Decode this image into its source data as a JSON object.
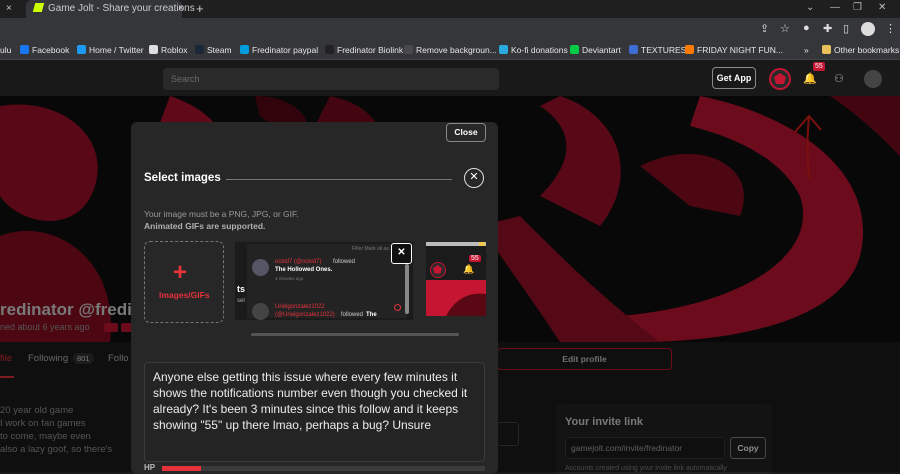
{
  "browser": {
    "tabs": [
      {
        "label": "× ",
        "active": false
      },
      {
        "label": "Game Jolt - Share your creations",
        "active": true
      }
    ],
    "close_glyph": "×",
    "new_tab_glyph": "+",
    "bookmarks": [
      {
        "label": "ulu",
        "color": "#1ce783"
      },
      {
        "label": "Facebook",
        "color": "#1877f2"
      },
      {
        "label": "Home / Twitter",
        "color": "#1d9bf0"
      },
      {
        "label": "Roblox",
        "color": "#dddddd"
      },
      {
        "label": "Steam",
        "color": "#1b2838"
      },
      {
        "label": "Fredinator paypal",
        "color": "#009cde"
      },
      {
        "label": "Fredinator Biolink",
        "color": "#222222"
      },
      {
        "label": "Remove backgroun...",
        "color": "#4a4a4a"
      },
      {
        "label": "Ko-fi donations",
        "color": "#29abe0"
      },
      {
        "label": "Deviantart",
        "color": "#05cc47"
      },
      {
        "label": "TEXTURES",
        "color": "#3f6dd3"
      },
      {
        "label": "FRIDAY NIGHT FUN...",
        "color": "#ff7a00"
      }
    ],
    "other_bookmarks": "Other bookmarks",
    "more_glyph": "»"
  },
  "header": {
    "search_placeholder": "Search",
    "get_app": "Get App",
    "notification_count": "55"
  },
  "profile": {
    "name": "redinator @fredinato",
    "joined": "ned about 6 years ago",
    "tabs": {
      "profile": "file",
      "following": "Following",
      "following_count": "801",
      "followers": "Follo"
    },
    "edit_profile": "Edit profile",
    "bio_lines": [
      "20 year old game",
      "I work on fan games",
      "to come, maybe even",
      "also a lazy goof, so there's"
    ],
    "invite": {
      "title": "Your invite link",
      "link": "gamejolt.com/invite/fredinator",
      "copy": "Copy",
      "note": "Accounts created using your invite link automatically"
    }
  },
  "modal": {
    "close": "Close",
    "title": "Select images",
    "hint": "Your image must be a PNG, JPG, or GIF.",
    "hint_bold": "Animated GIFs are supported.",
    "add_label": "Images/GIFs",
    "post_text": "Anyone else getting this issue where every few minutes it shows the notifications number even though you checked it already? It's been 3 minutes since this follow and it keeps showing \"55\" up there lmao, perhaps a bug? Unsure",
    "hp_label": "HP",
    "hp_fraction": 0.12,
    "thumb": {
      "filter": "Filter",
      "mark_all": "Mark all as",
      "n1_user": "ockid7 (@ockid7)",
      "n1_action": "followed",
      "n1_target": "The Hollowed Ones.",
      "n1_time": "4 minutes ago",
      "n2_user": "Urielgonzalez1022",
      "n2_handle": "(@Urielgonzalez1022)",
      "n2_action": "followed",
      "n2_target": "The",
      "side_text": "ts",
      "side_text2": "ser",
      "badge": "55"
    }
  },
  "colors": {
    "accent": "#e5323b",
    "banner_red": "#c41533",
    "annotation_red": "#e0201b"
  }
}
